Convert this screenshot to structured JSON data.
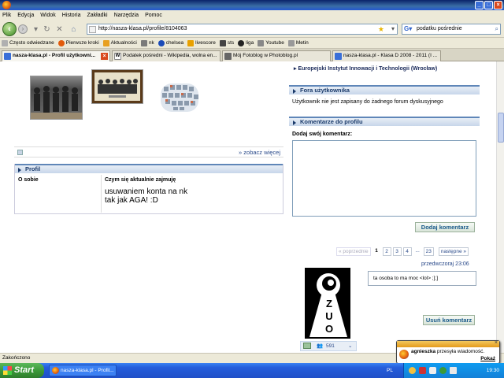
{
  "menu": [
    "Plik",
    "Edycja",
    "Widok",
    "Historia",
    "Zakładki",
    "Narzędzia",
    "Pomoc"
  ],
  "url": "http://nasza-klasa.pl/profile/8104063",
  "search_value": "podatku pośrednie",
  "bookmarks": [
    {
      "label": "Często odwiedzane",
      "color": "#b0b0b0"
    },
    {
      "label": "Pierwsze kroki",
      "color": "#e25b0c"
    },
    {
      "label": "Aktualności",
      "color": "#e8a020"
    },
    {
      "label": "nk",
      "color": "#7a7a7a"
    },
    {
      "label": "chelsea",
      "color": "#1a4ab8"
    },
    {
      "label": "livescore",
      "color": "#e8a000"
    },
    {
      "label": "sts",
      "color": "#444"
    },
    {
      "label": "liga",
      "color": "#222"
    },
    {
      "label": "Youtube",
      "color": "#888"
    },
    {
      "label": "Metin",
      "color": "#999"
    }
  ],
  "tabs": [
    {
      "label": "nasza-klasa.pl - Profil użytkowni...",
      "active": true
    },
    {
      "label": "Podatek pośredni - Wikipedia, wolna en...",
      "active": false
    },
    {
      "label": "Mój Fotoblog w Photoblog.pl",
      "active": false
    },
    {
      "label": "nasza-klasa.pl - Klasa D 2008 - 2011 (I ...",
      "active": false
    }
  ],
  "left": {
    "see_more": "zobacz więcej",
    "profile_title": "Profil",
    "about_label": "O sobie",
    "doing_label": "Czym się aktualnie zajmuję",
    "doing_value_line1": "usuwaniem konta na nk",
    "doing_value_line2": "tak jak AGA! :D"
  },
  "right": {
    "school": "Europejski Instytut Innowacji i Technologii (Wrocław)",
    "forums_title": "Fora użytkownika",
    "forums_text": "Użytkownik nie jest zapisany do żadnego forum dyskusyjnego",
    "comments_title": "Komentarze do profilu",
    "add_comment_label": "Dodaj swój komentarz:",
    "add_comment_button": "Dodaj komentarz",
    "pager_prev": "poprzednie",
    "pages": [
      "1",
      "2",
      "3",
      "4",
      "...",
      "23"
    ],
    "current_page": "1",
    "pager_next": "następne",
    "comment_time": "przedwczoraj 23:06",
    "comment_text": "ta osoba to ma moc <lol> ;];]",
    "delete_comment_button": "Usuń komentarz",
    "comment_count": "591"
  },
  "status": "Zakończono",
  "taskbar": {
    "start": "Start",
    "task": "nasza-klasa.pl - Profil...",
    "lang": "PL",
    "clock": "19:30"
  },
  "notification": {
    "sender": "agnieszka",
    "message": "przesyła wiadomość.",
    "action": "Pokaż"
  }
}
